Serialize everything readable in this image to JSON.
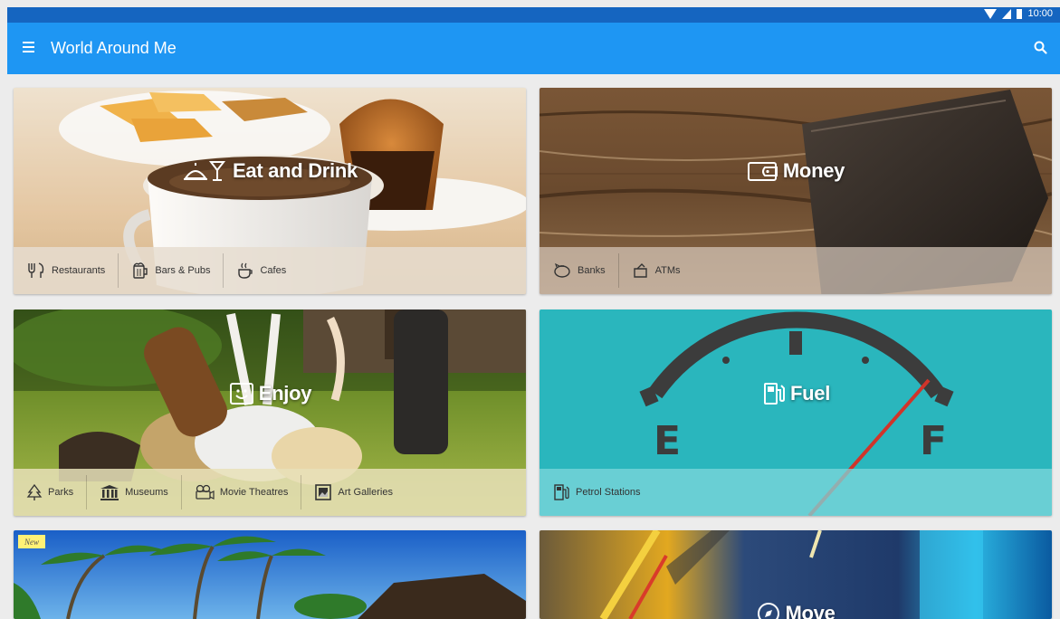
{
  "status_bar": {
    "time": "10:00"
  },
  "app_bar": {
    "title": "World Around Me"
  },
  "categories": [
    {
      "title": "Eat and Drink",
      "subcategories": [
        "Restaurants",
        "Bars & Pubs",
        "Cafes"
      ]
    },
    {
      "title": "Money",
      "subcategories": [
        "Banks",
        "ATMs"
      ]
    },
    {
      "title": "Enjoy",
      "subcategories": [
        "Parks",
        "Museums",
        "Movie Theatres",
        "Art Galleries"
      ]
    },
    {
      "title": "Fuel",
      "subcategories": [
        "Petrol Stations"
      ]
    },
    {
      "title": "",
      "badge": "New",
      "subcategories": []
    },
    {
      "title": "Move",
      "subcategories": []
    }
  ],
  "gauge_labels": {
    "empty": "E",
    "full": "F"
  },
  "colors": {
    "status_bar": "#1565c0",
    "app_bar": "#1e96f3",
    "fuel_card": "#2ab6bd",
    "background": "#ececec"
  }
}
